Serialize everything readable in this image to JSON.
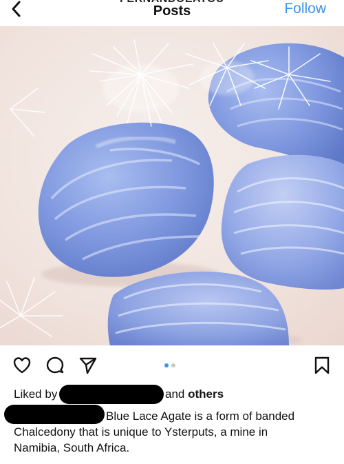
{
  "header": {
    "username": "FERNANDOEATOU",
    "title": "Posts",
    "follow_label": "Follow"
  },
  "post": {
    "carousel": {
      "total": 2,
      "active": 1
    },
    "likes": {
      "prefix": "Liked by",
      "connector": "and",
      "others": "others"
    },
    "caption": {
      "line1": "Blue Lace Agate is a form of banded",
      "line2": "Chalcedony that is unique to Ysterputs, a mine in",
      "line3": "Namibia, South Africa."
    }
  },
  "colors": {
    "accent": "#3c93ee",
    "dot_active": "#3c93ee",
    "dot_inactive": "#c7c7c7",
    "text": "#111111"
  },
  "icons": {
    "back": "chevron-left-icon",
    "like": "heart-icon",
    "comment": "comment-icon",
    "share": "send-icon",
    "save": "bookmark-icon"
  }
}
